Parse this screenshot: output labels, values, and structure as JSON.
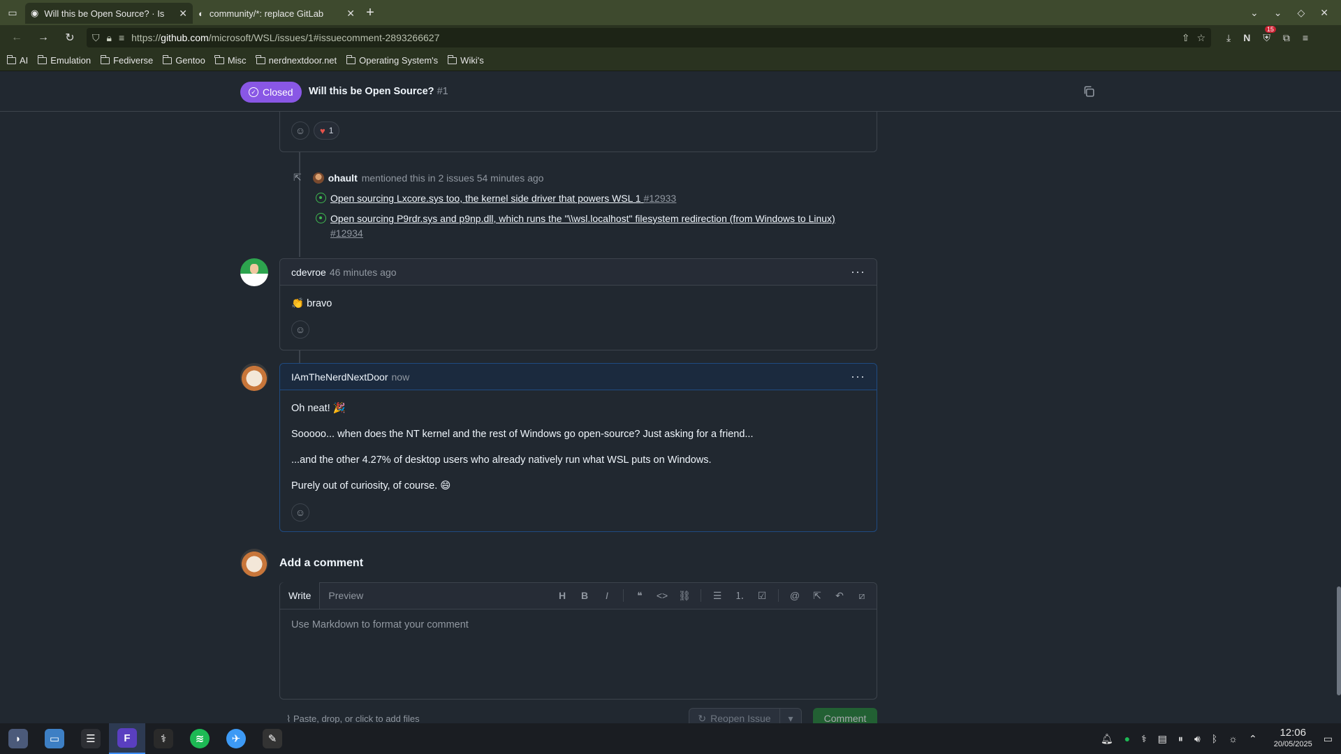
{
  "browser": {
    "tabs": [
      {
        "title": "Will this be Open Source? · Is",
        "active": true
      },
      {
        "title": "community/*: replace GitLab",
        "active": false
      }
    ],
    "url_prefix": "https://",
    "url_host": "github.com",
    "url_path": "/microsoft/WSL/issues/1#issuecomment-2893266627",
    "ext_badge_count": "15",
    "profile_letter": "N",
    "bookmarks": [
      "AI",
      "Emulation",
      "Fediverse",
      "Gentoo",
      "Misc",
      "nerdnextdoor.net",
      "Operating System's",
      "Wiki's"
    ]
  },
  "issue": {
    "state": "Closed",
    "title": "Will this be Open Source?",
    "number": "#1"
  },
  "prev_comment": {
    "heart_count": "1"
  },
  "mention_event": {
    "user": "ohault",
    "text": "mentioned this in 2 issues 54 minutes ago",
    "refs": [
      {
        "title": "Open sourcing Lxcore.sys too, the kernel side driver that powers WSL 1",
        "num": "#12933"
      },
      {
        "title": "Open sourcing P9rdr.sys and p9np.dll, which runs the \"\\\\wsl.localhost\" filesystem redirection (from Windows to Linux)",
        "num": "#12934"
      }
    ]
  },
  "comments": [
    {
      "author": "cdevroe",
      "time": "46 minutes ago",
      "body": [
        "👏 bravo"
      ]
    },
    {
      "author": "IAmTheNerdNextDoor",
      "time": "now",
      "body": [
        "Oh neat! 🎉",
        "Sooooo... when does the NT kernel and the rest of Windows go open-source? Just asking for a friend...",
        "...and the other 4.27% of desktop users who already natively run what WSL puts on Windows.",
        "Purely out of curiosity, of course. 😄"
      ]
    }
  ],
  "composer": {
    "title": "Add a comment",
    "tab_write": "Write",
    "tab_preview": "Preview",
    "placeholder": "Use Markdown to format your comment",
    "attach_text": "Paste, drop, or click to add files",
    "reopen_label": "Reopen Issue",
    "comment_label": "Comment"
  },
  "taskbar": {
    "time": "12:06",
    "date": "20/05/2025"
  }
}
